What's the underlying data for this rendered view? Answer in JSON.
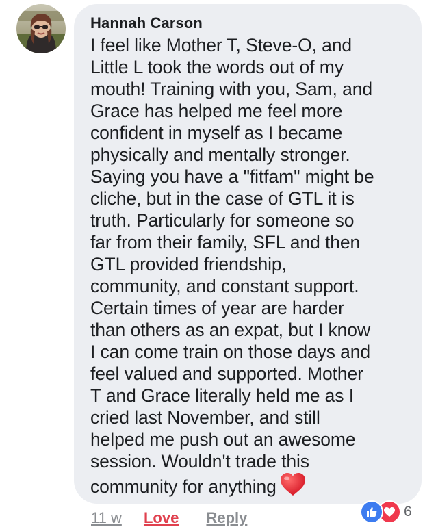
{
  "comment": {
    "author": "Hannah Carson",
    "text": "I feel like Mother T, Steve-O, and\nLittle L took the words out of my\nmouth! Training with you, Sam, and\nGrace has helped me feel more\nconfident in myself as I became\nphysically and mentally stronger.\nSaying you have a \"fitfam\" might be\ncliche, but in the case of GTL it is\ntruth. Particularly for someone so\nfar from their family, SFL and then\nGTL provided friendship,\ncommunity, and constant support.\nCertain times of year are harder\nthan others as an expat, but I know\nI can come train on those days and\nfeel valued and supported. Mother\nT and Grace literally held me as I\ncried last November,  and still\nhelped me push out an awesome\nsession. Wouldn't trade this\ncommunity for anything",
    "trailing_emoji": "heart-emoji"
  },
  "actions": {
    "time": "11 w",
    "love_label": "Love",
    "reply_label": "Reply"
  },
  "reactions": {
    "icons": [
      "like-icon",
      "love-icon"
    ],
    "count": "6"
  },
  "colors": {
    "bubble": "#eceef2",
    "love_accent": "#e0404e",
    "like_blue": "#3d7cf0",
    "love_red": "#f0384d",
    "meta_gray": "#8a8d91"
  }
}
